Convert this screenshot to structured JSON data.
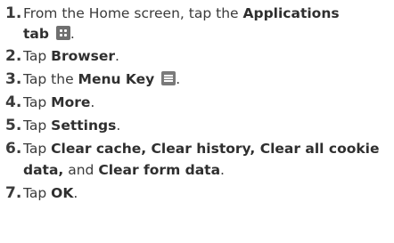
{
  "steps": [
    {
      "num": "1.",
      "pre": "From the Home screen, tap the ",
      "bold": "Applications",
      "cont_bold": "tab",
      "icon": "apps-grid-icon"
    },
    {
      "num": "2.",
      "pre": "Tap ",
      "bold": "Browser",
      "post": "."
    },
    {
      "num": "3.",
      "pre": "Tap the ",
      "bold": "Menu Key",
      "icon": "menu-key-icon"
    },
    {
      "num": "4.",
      "pre": "Tap ",
      "bold": "More",
      "post": "."
    },
    {
      "num": "5.",
      "pre": "Tap ",
      "bold": "Settings",
      "post": "."
    },
    {
      "num": "6.",
      "pre": "Tap ",
      "bold": "Clear cache, Clear history, Clear all cookie",
      "cont_bold": "data,",
      "cont_mid": " and ",
      "cont_bold2": "Clear form data",
      "cont_post": "."
    },
    {
      "num": "7.",
      "pre": "Tap ",
      "bold": "OK",
      "post": "."
    }
  ],
  "punct": {
    "period": "."
  }
}
